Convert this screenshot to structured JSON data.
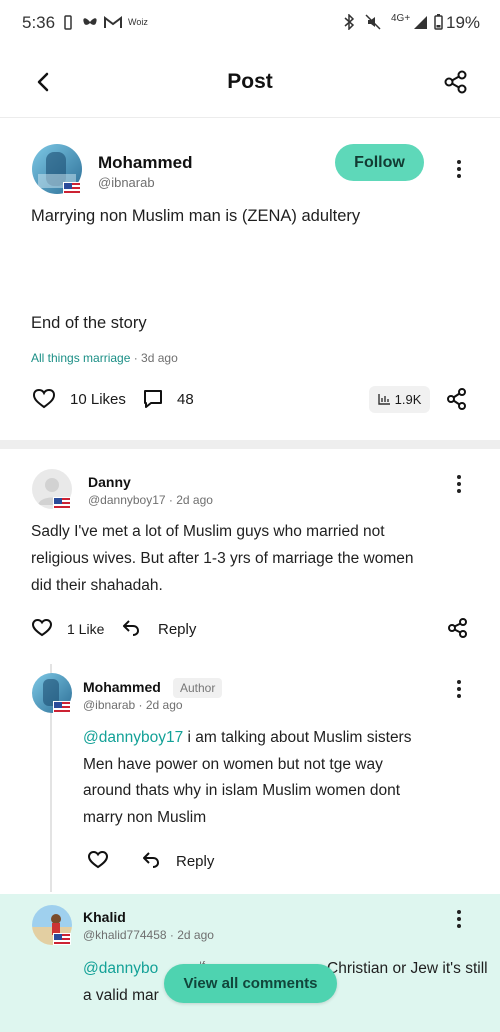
{
  "status_bar": {
    "time": "5:36",
    "carrier_label": "Woiz",
    "network": "4G+",
    "battery": "19%"
  },
  "header": {
    "title": "Post"
  },
  "post": {
    "author_name": "Mohammed",
    "author_handle": "@ibnarab",
    "follow_label": "Follow",
    "line1": "Marrying non Muslim man is (ZENA) adultery",
    "line2": "End of the story",
    "topic": "All things marriage",
    "time": " · 3d ago",
    "likes": "10 Likes",
    "comments": "48",
    "views": "1.9K"
  },
  "comments": [
    {
      "name": "Danny",
      "meta": "@dannyboy17 · 2d ago",
      "lines": [
        "Sadly I've met a lot of Muslim guys who married not",
        "religious wives. But after 1-3 yrs of marriage the women",
        "did their shahadah."
      ],
      "likes": "1 Like",
      "reply_label": "Reply"
    },
    {
      "name": "Mohammed",
      "badge": "Author",
      "meta": "@ibnarab · 2d ago",
      "mention": "@dannyboy17",
      "lines": [
        " i am talking about Muslim sisters",
        "Men have power on women but not tge way",
        "around thats why in islam Muslim women dont",
        "marry non Muslim"
      ],
      "reply_label": "Reply"
    },
    {
      "name": "Khalid",
      "meta": "@khalid774458 · 2d ago",
      "mention": "@dannybo",
      "lines": [
        "If ...",
        "Christian or Jew it's still",
        "a valid mar"
      ]
    }
  ],
  "view_all_label": "View all comments",
  "colors": {
    "accent": "#5ed8b9",
    "link": "#1b8f86",
    "highlight": "#def6ef"
  }
}
